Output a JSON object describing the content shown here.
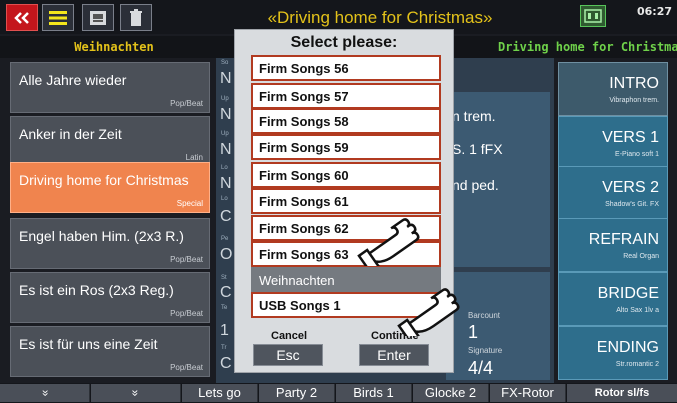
{
  "top": {
    "title": "«Driving home for Christmas»",
    "clock": "06:27"
  },
  "header": {
    "left": "Weihnachten",
    "right": "Driving home for Christmas"
  },
  "songs": [
    {
      "name": "Alle Jahre wieder",
      "style": "Pop/Beat"
    },
    {
      "name": "Anker in der Zeit",
      "style": "Latin"
    },
    {
      "name": "Driving home for Christmas",
      "style": "Special"
    },
    {
      "name": "Engel haben Him. (2x3 R.)",
      "style": "Pop/Beat"
    },
    {
      "name": "Es ist ein Ros (2x3 Reg.)",
      "style": "Pop/Beat"
    },
    {
      "name": "Es ist für uns eine Zeit",
      "style": "Pop/Beat"
    }
  ],
  "parts": [
    {
      "name": "INTRO",
      "sub": "Vibraphon trem."
    },
    {
      "name": "VERS 1",
      "sub": "E-Piano soft 1"
    },
    {
      "name": "VERS 2",
      "sub": "Shadow's Git. FX"
    },
    {
      "name": "REFRAIN",
      "sub": "Real Organ"
    },
    {
      "name": "BRIDGE",
      "sub": "Alto Sax 1lv a"
    },
    {
      "name": "ENDING",
      "sub": "Str.romantic 2"
    }
  ],
  "center": {
    "line1": "n trem.",
    "line2": "S. 1 fFX",
    "line3": "nd ped.",
    "barcount_label": "Barcount",
    "barcount_value": "1",
    "signature_label": "Signature",
    "signature_value": "4/4",
    "col_glyphs": [
      "N",
      "N",
      "N",
      "N",
      "O",
      "C",
      "C",
      "1",
      "C"
    ],
    "col_tiny": [
      "So",
      "Up",
      "Up",
      "Lo",
      "Lo",
      "Pe",
      "St",
      "Te",
      "Tr"
    ]
  },
  "dialog": {
    "title": "Select please:",
    "items": [
      "Firm Songs 56",
      "Firm Songs 57",
      "Firm Songs 58",
      "Firm Songs 59",
      "Firm Songs 60",
      "Firm Songs 61",
      "Firm Songs 62",
      "Firm Songs 63",
      "Weihnachten",
      "USB Songs 1"
    ],
    "cancel_label": "Cancel",
    "continue_label": "Continue",
    "esc": "Esc",
    "enter": "Enter"
  },
  "bottom": {
    "up": "«",
    "down": "»",
    "buttons": [
      "Lets go",
      "Party 2",
      "Birds 1",
      "Glocke 2",
      "FX-Rotor",
      "Rotor sl/fs"
    ]
  },
  "colors": {
    "title": "#e3c21a",
    "active_song": "#f0844e",
    "part": "#2e6e8c",
    "accent_green": "#6fd14a",
    "dialog_border": "#b13a20"
  },
  "icons": [
    "back-icon",
    "menu-icon",
    "usb-icon",
    "trash-icon",
    "keyboard-icon",
    "hand-pointer-icon"
  ]
}
